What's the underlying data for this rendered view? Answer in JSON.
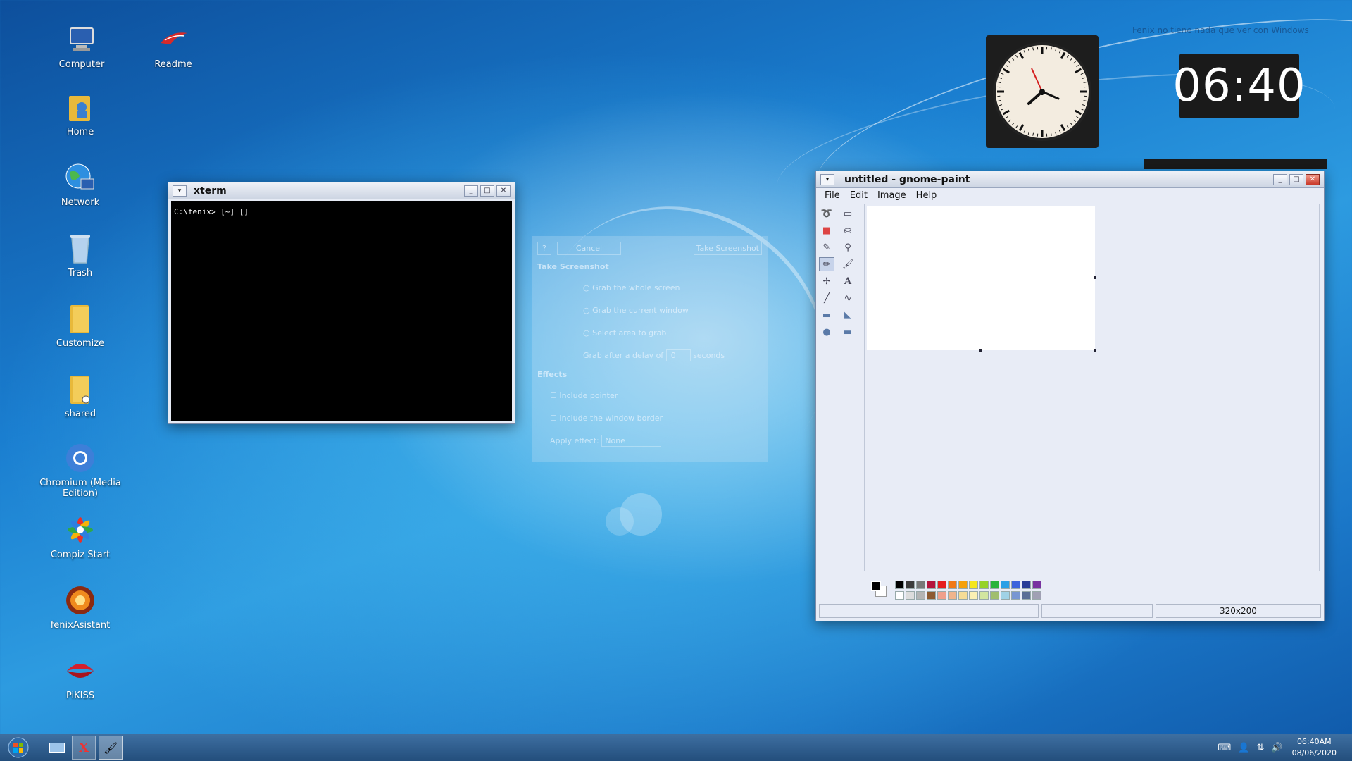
{
  "desktop": {
    "watermark": "Fenix no tiene nada que ver con Windows",
    "icons": [
      {
        "label": "Computer",
        "icon": "computer-icon"
      },
      {
        "label": "Readme",
        "icon": "readme-icon"
      },
      {
        "label": "Home",
        "icon": "home-folder-icon"
      },
      {
        "label": "Network",
        "icon": "network-globe-icon"
      },
      {
        "label": "Trash",
        "icon": "trash-icon"
      },
      {
        "label": "Customize",
        "icon": "folder-icon"
      },
      {
        "label": "shared",
        "icon": "shared-folder-icon"
      },
      {
        "label": "Chromium (Media Edition)",
        "icon": "chromium-icon"
      },
      {
        "label": "Compiz Start",
        "icon": "compiz-icon"
      },
      {
        "label": "fenixAsistant",
        "icon": "fenix-assistant-icon"
      },
      {
        "label": "PiKISS",
        "icon": "pikiss-icon"
      }
    ]
  },
  "digital_clock": {
    "time": "06:40"
  },
  "screenshot_dialog": {
    "cancel": "Cancel",
    "take": "Take Screenshot",
    "heading": "Take Screenshot",
    "options": [
      "Grab the whole screen",
      "Grab the current window",
      "Select area to grab"
    ],
    "delay_label": "Grab after a delay of",
    "delay_value": "0",
    "delay_unit": "seconds",
    "effects_heading": "Effects",
    "include_pointer": "Include pointer",
    "include_border": "Include the window border",
    "apply_effect": "Apply effect:",
    "effect_value": "None"
  },
  "xterm": {
    "title": "xterm",
    "prompt": "C:\\fenix> [~] []"
  },
  "paint": {
    "title": "untitled - gnome-paint",
    "menu": [
      "File",
      "Edit",
      "Image",
      "Help"
    ],
    "status_size": "320x200",
    "palette_top": [
      "#000000",
      "#3c3c3c",
      "#787878",
      "#b4143c",
      "#e61e1e",
      "#f07814",
      "#f5a00a",
      "#f5e61e",
      "#96d228",
      "#28b43c",
      "#28a0e6",
      "#3c64dc",
      "#283c96",
      "#7832a0"
    ],
    "palette_bottom": [
      "#ffffff",
      "#dcdcdc",
      "#b4b4b4",
      "#8c5a32",
      "#f0a08c",
      "#f0b48c",
      "#f5dc96",
      "#faf0b4",
      "#d2e6a0",
      "#a0be6e",
      "#a0d2e6",
      "#7896d2",
      "#5a6e96",
      "#a0a0b4"
    ]
  },
  "taskbar": {
    "clock_time": "06:40AM",
    "clock_date": "08/06/2020"
  }
}
